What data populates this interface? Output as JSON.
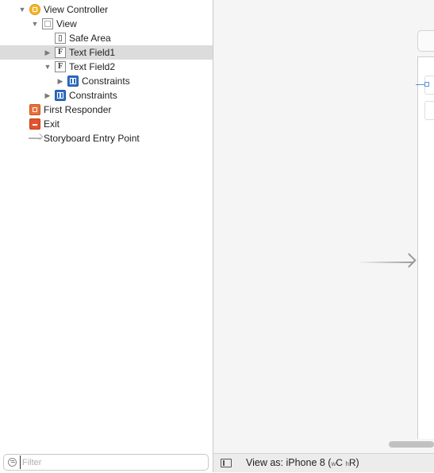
{
  "outline": {
    "items": [
      {
        "label": "View Controller"
      },
      {
        "label": "View"
      },
      {
        "label": "Safe Area"
      },
      {
        "label": "Text Field1"
      },
      {
        "label": "Text Field2"
      },
      {
        "label": "Constraints"
      },
      {
        "label": "Constraints"
      },
      {
        "label": "First Responder"
      },
      {
        "label": "Exit"
      },
      {
        "label": "Storyboard Entry Point"
      }
    ],
    "text_field_glyph": "F",
    "disclosure_expanded": "▼",
    "disclosure_collapsed": "▶",
    "filter": {
      "placeholder": "Filter",
      "value": ""
    }
  },
  "bottom_bar": {
    "view_as_prefix": "View as: iPhone 8 (",
    "width_class_prefix": "w",
    "width_class": "C",
    "height_class_prefix": "h",
    "height_class": "R",
    "suffix": ")"
  },
  "colors": {
    "selection": "#dcdcdc",
    "view_controller_icon": "#f5b52e",
    "constraints_icon": "#2f6fc2",
    "first_responder_icon": "#e8703a",
    "exit_icon": "#e2542e",
    "canvas_background": "#f5f5f5"
  }
}
